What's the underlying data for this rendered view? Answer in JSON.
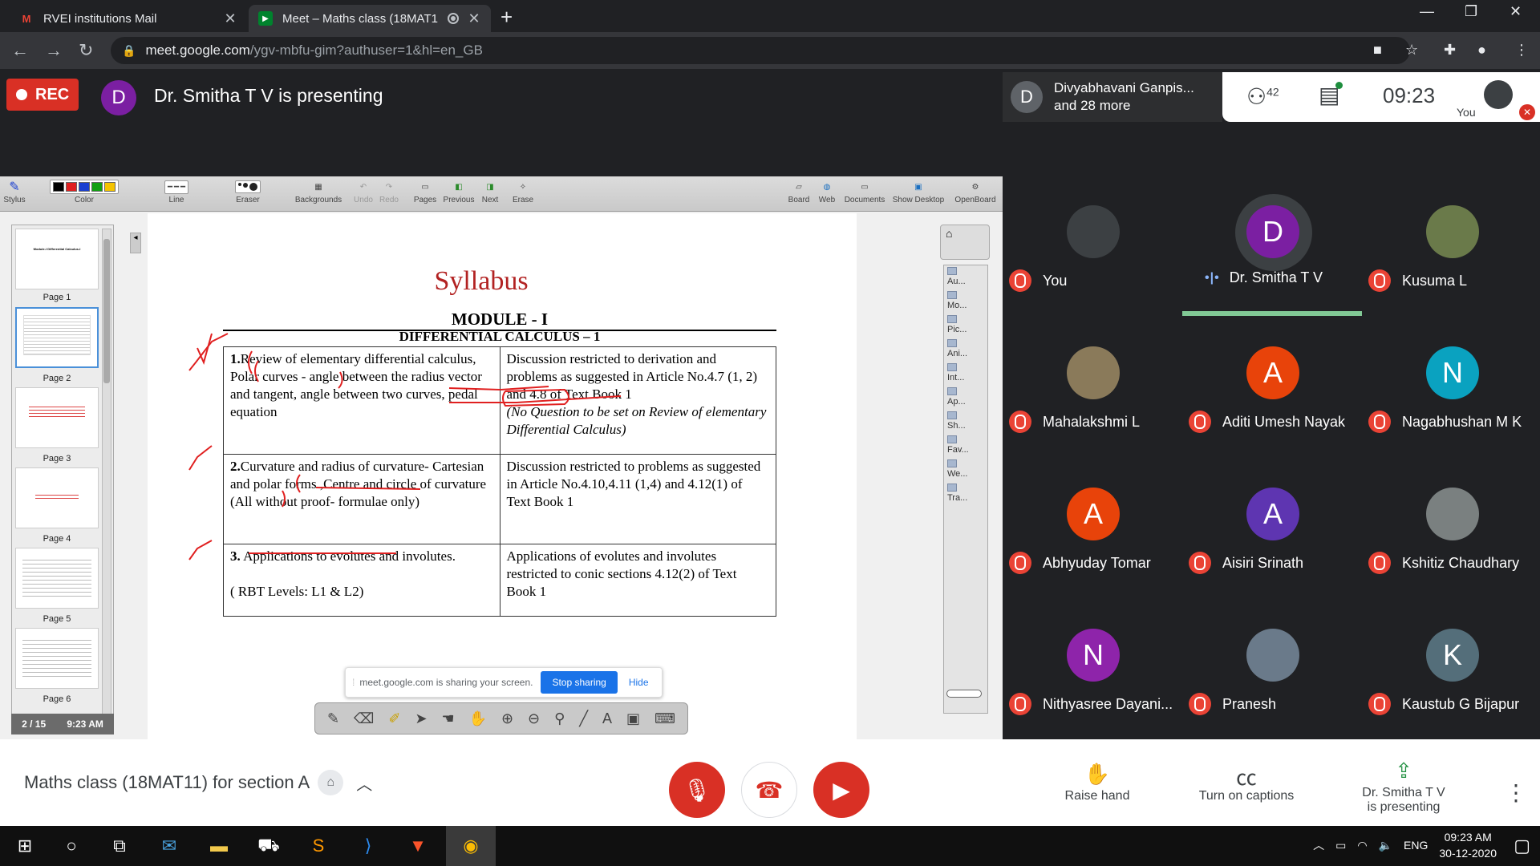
{
  "browser": {
    "tabs": [
      {
        "title": "RVEI institutions Mail",
        "icon": "gmail-icon"
      },
      {
        "title": "Meet – Maths class (18MAT1",
        "icon": "meet-icon",
        "active": true
      }
    ],
    "url_host": "meet.google.com",
    "url_path": "/ygv-mbfu-gim?authuser=1&hl=en_GB"
  },
  "meet": {
    "rec_label": "REC",
    "presenter_initial": "D",
    "presenter_text": "Dr. Smitha T V is presenting",
    "joined_initial": "D",
    "joined_line1": "Divyabhavani Ganpis...",
    "joined_line2": "and 28 more",
    "people_count": "42",
    "time": "09:23",
    "you_label": "You",
    "meeting_name": "Maths class (18MAT11) for section A",
    "raise_hand": "Raise hand",
    "captions": "Turn on captions",
    "presenting_line1": "Dr. Smitha T V",
    "presenting_line2": "is presenting"
  },
  "openboard": {
    "tools": [
      "Stylus",
      "Color",
      "Line",
      "Eraser",
      "Backgrounds",
      "Undo",
      "Redo",
      "Pages",
      "Previous",
      "Next",
      "Erase"
    ],
    "right_tools": [
      "Board",
      "Web",
      "Documents",
      "Show Desktop",
      "OpenBoard"
    ],
    "pages": [
      "Page 1",
      "Page 2",
      "Page 3",
      "Page 4",
      "Page 5",
      "Page 6"
    ],
    "page_counter": "2 / 15",
    "page_time": "9:23 AM",
    "library_items": [
      "Au...",
      "Mo...",
      "Pic...",
      "Ani...",
      "Int...",
      "Ap...",
      "Sh...",
      "Fav...",
      "We...",
      "Tra..."
    ],
    "thumb_title": "Module-I Differential Calculus-I",
    "colors": [
      "#000000",
      "#e02020",
      "#1a3fd0",
      "#11a011",
      "#f5c400"
    ]
  },
  "slide": {
    "title": "Syllabus",
    "module": "MODULE - I",
    "subtitle": "DIFFERENTIAL CALCULUS – 1",
    "rows": [
      {
        "left_num": "1.",
        "left": "Review of elementary differential calculus, Polar curves - angle between the radius vector and tangent, angle between two curves, pedal equation",
        "right": "Discussion restricted to derivation and problems as suggested in Article No.4.7 (1, 2) and 4.8 of Text Book 1",
        "right_italic": "(No Question to be set on Review of elementary Differential Calculus)"
      },
      {
        "left_num": "2.",
        "left": "Curvature and radius of curvature- Cartesian and  polar forms ,Centre and circle of curvature (All without proof- formulae only)",
        "right": "Discussion restricted to problems as suggested in Article No.4.10,4.11 (1,4) and 4.12(1) of Text Book 1",
        "right_italic": ""
      },
      {
        "left_num": "3.",
        "left": "Applications to evolutes and involutes.",
        "left_extra": "( RBT Levels: L1 & L2)",
        "right": "Applications of evolutes and involutes restricted to conic sections 4.12(2) of Text Book 1",
        "right_italic": ""
      }
    ]
  },
  "share": {
    "text": "meet.google.com is sharing your screen.",
    "stop": "Stop sharing",
    "hide": "Hide"
  },
  "participants": [
    {
      "name": "You",
      "initial": "",
      "color": "#3c4043",
      "muted": true
    },
    {
      "name": "Dr. Smitha T V",
      "initial": "D",
      "color": "#7b1fa2",
      "muted": false,
      "active": true
    },
    {
      "name": "Kusuma L",
      "initial": "",
      "color": "#6a7a4a",
      "muted": true
    },
    {
      "name": "Mahalakshmi L",
      "initial": "",
      "color": "#8a7a5a",
      "muted": true
    },
    {
      "name": "Aditi Umesh Nayak",
      "initial": "A",
      "color": "#e8430a",
      "muted": true
    },
    {
      "name": "Nagabhushan M K",
      "initial": "N",
      "color": "#0aa2c0",
      "muted": true
    },
    {
      "name": "Abhyuday Tomar",
      "initial": "A",
      "color": "#e8430a",
      "muted": true
    },
    {
      "name": "Aisiri Srinath",
      "initial": "A",
      "color": "#5e35b1",
      "muted": true
    },
    {
      "name": "Kshitiz Chaudhary",
      "initial": "",
      "color": "#7a8080",
      "muted": true
    },
    {
      "name": "Nithyasree Dayani...",
      "initial": "N",
      "color": "#8e24aa",
      "muted": true
    },
    {
      "name": "Pranesh",
      "initial": "",
      "color": "#6a7a8a",
      "muted": true
    },
    {
      "name": "Kaustub G Bijapur",
      "initial": "K",
      "color": "#546e7a",
      "muted": true
    }
  ],
  "taskbar": {
    "lang": "ENG",
    "time": "09:23 AM",
    "date": "30-12-2020"
  }
}
